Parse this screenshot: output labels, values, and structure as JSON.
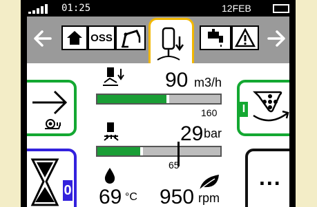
{
  "status_bar": {
    "time": "01:25",
    "date": "12FEB"
  },
  "nav": {
    "tabs": [
      {
        "name": "home",
        "icon": "home-icon"
      },
      {
        "name": "oss",
        "label": "OSS"
      },
      {
        "name": "crane",
        "icon": "crane-icon"
      },
      {
        "name": "flow",
        "icon": "flow-nozzle-icon",
        "active": true
      },
      {
        "name": "tap",
        "icon": "tap-icon"
      },
      {
        "name": "warning",
        "icon": "warning-icon"
      }
    ],
    "active_color": "#f2b700"
  },
  "flow": {
    "value": "90",
    "unit": "m3/h",
    "limit": "160",
    "level": 0.56
  },
  "pressure": {
    "value": "29",
    "unit": "bar",
    "limit": "65",
    "level": 0.35,
    "marker": 0.65
  },
  "temperature": {
    "value": "69",
    "unit": "°C"
  },
  "speed": {
    "value": "950",
    "unit": "rpm"
  },
  "side_buttons": {
    "wash_tag": "I",
    "hourglass_tag": "0",
    "more_label": "..."
  },
  "colors": {
    "green": "#14a832",
    "blue": "#3322dd",
    "yellow": "#f2b700",
    "nav_gray": "#9a9a9a"
  }
}
